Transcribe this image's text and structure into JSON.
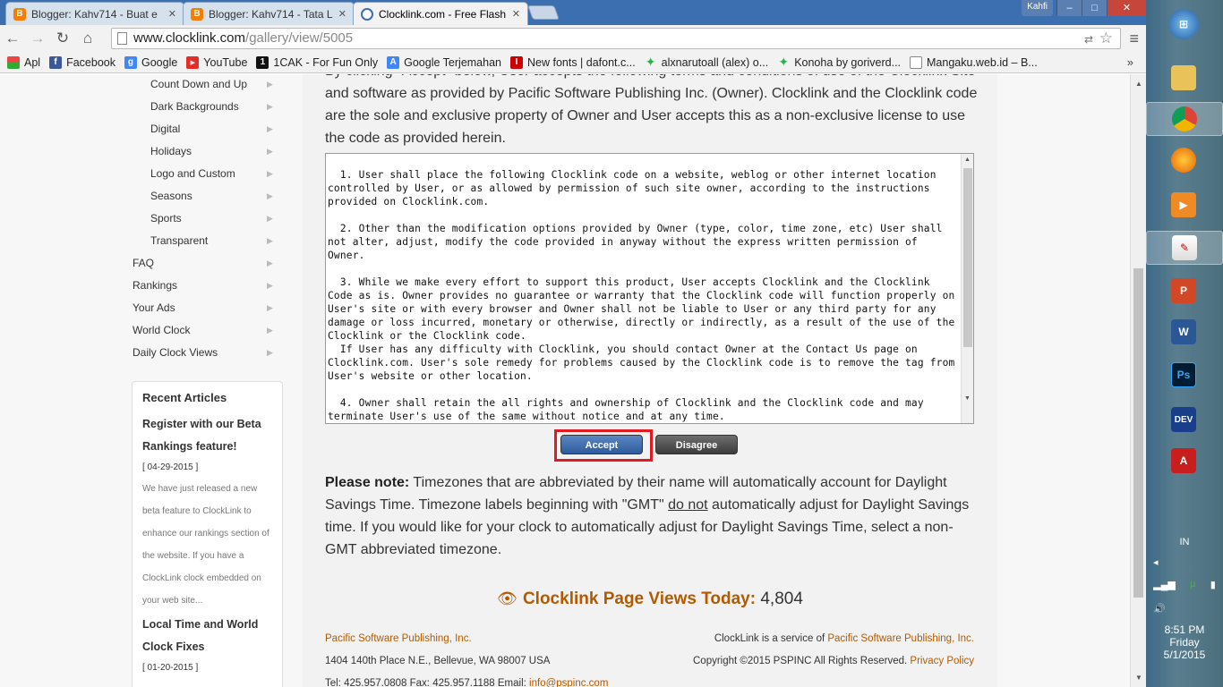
{
  "tabs": [
    {
      "label": "Blogger: Kahv714 - Buat e",
      "icon": "blogger-icon"
    },
    {
      "label": "Blogger: Kahv714 - Tata L",
      "icon": "blogger-icon"
    },
    {
      "label": "Clocklink.com - Free Flash",
      "icon": "clocklink-icon"
    }
  ],
  "window": {
    "user": "Kahfi",
    "min": "–",
    "max": "□",
    "close": "✕"
  },
  "toolbar": {
    "url_host": "www.clocklink.com",
    "url_path": "/gallery/view/5005"
  },
  "bookmarks": [
    {
      "label": "Apl",
      "color": "#e44"
    },
    {
      "label": "Facebook",
      "color": "#3b5998",
      "glyph": "f"
    },
    {
      "label": "Google",
      "color": "#4285f4",
      "glyph": "g"
    },
    {
      "label": "YouTube",
      "color": "#e52d27",
      "glyph": "▶"
    },
    {
      "label": "1CAK - For Fun Only",
      "color": "#111",
      "glyph": "1"
    },
    {
      "label": "Google Terjemahan",
      "color": "#4285f4",
      "glyph": "A"
    },
    {
      "label": "New fonts | dafont.c...",
      "color": "#c00",
      "glyph": "I"
    },
    {
      "label": "alxnarutoall (alex) o...",
      "color": "#2bb24c",
      "glyph": "✦"
    },
    {
      "label": "Konoha by goriverd...",
      "color": "#2bb24c",
      "glyph": "✦"
    },
    {
      "label": "Mangaku.web.id – B...",
      "color": "#fff",
      "glyph": ""
    }
  ],
  "bookmarks_more": "»",
  "sidebar": {
    "subitems": [
      "Count Down and Up",
      "Dark Backgrounds",
      "Digital",
      "Holidays",
      "Logo and Custom",
      "Seasons",
      "Sports",
      "Transparent"
    ],
    "items": [
      "FAQ",
      "Rankings",
      "Your Ads",
      "World Clock",
      "Daily Clock Views"
    ],
    "recent_title": "Recent Articles",
    "articles": [
      {
        "title": "Register with our Beta Rankings feature!",
        "date": "[ 04-29-2015 ]",
        "text": "We have just released a new beta feature to ClockLink to enhance our rankings section of the website. If you have a ClockLink clock embedded on your web site..."
      },
      {
        "title": "Local Time and World Clock Fixes",
        "date": "[ 01-20-2015 ]"
      }
    ]
  },
  "intro": "By clicking \"Accept\" below, User accepts the following terms and conditions of use of the Clocklink Site and software as provided by Pacific Software Publishing Inc. (Owner). Clocklink and the Clocklink code are the sole and exclusive property of Owner and User accepts this as a non-exclusive license to use the code as provided herein.",
  "terms": "  1. User shall place the following Clocklink code on a website, weblog or other internet location controlled by User, or as allowed by permission of such site owner, according to the instructions provided on Clocklink.com.\n\n  2. Other than the modification options provided by Owner (type, color, time zone, etc) User shall not alter, adjust, modify the code provided in anyway without the express written permission of Owner.\n\n  3. While we make every effort to support this product, User accepts Clocklink and the Clocklink Code as is. Owner provides no guarantee or warranty that the Clocklink code will function properly on User's site or with every browser and Owner shall not be liable to User or any third party for any damage or loss incurred, monetary or otherwise, directly or indirectly, as a result of the use of the Clocklink or the Clocklink code.\n  If User has any difficulty with Clocklink, you should contact Owner at the Contact Us page on Clocklink.com. User's sole remedy for problems caused by the Clocklink code is to remove the tag from User's website or other location.\n\n  4. Owner shall retain the all rights and ownership of Clocklink and the Clocklink code and may terminate User's use of the same without notice and at any time.",
  "buttons": {
    "accept": "Accept",
    "disagree": "Disagree"
  },
  "note": {
    "lead": "Please note:",
    "p1": " Timezones that are abbreviated by their name will automatically account for Daylight Savings Time. Timezone labels beginning with \"GMT\" ",
    "u": "do not",
    "p2": " automatically adjust for Daylight Savings time. If you would like for your clock to automatically adjust for Daylight Savings Time, select a non-GMT abbreviated timezone."
  },
  "views": {
    "label": "Clocklink Page Views Today:",
    "value": "4,804"
  },
  "footer": {
    "company": "Pacific Software Publishing, Inc.",
    "address": "1404 140th Place N.E., Bellevue, WA 98007 USA",
    "tel": "Tel: 425.957.0808 Fax: 425.957.1188 Email: ",
    "email": "info@pspinc.com",
    "service_pre": "ClockLink is a service of ",
    "service_link": "Pacific Software Publishing, Inc.",
    "copyright": "Copyright ©2015 PSPINC All Rights Reserved. ",
    "privacy": "Privacy Policy"
  },
  "taskbar": {
    "lang": "IN",
    "time": "8:51 PM",
    "day": "Friday",
    "date": "5/1/2015"
  }
}
